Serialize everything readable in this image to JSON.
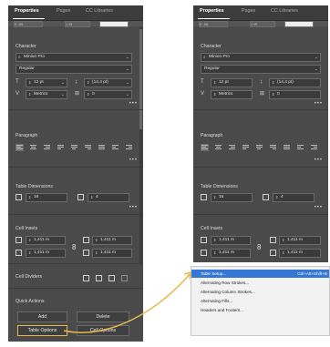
{
  "tabs": [
    "Properties",
    "Pages",
    "CC Libraries"
  ],
  "top_strip": {
    "left": "E..55",
    "mid": "1 IR"
  },
  "character": {
    "heading": "Character",
    "font": "Minion Pro",
    "style": "Regular",
    "size": "12 pt",
    "leading": "(14,4 pt)",
    "kerning": "Metrics",
    "tracking": "0"
  },
  "paragraph": {
    "heading": "Paragraph"
  },
  "table_dimensions": {
    "heading": "Table Dimensions",
    "rows": "16",
    "columns": "4"
  },
  "cell_insets": {
    "heading": "Cell Insets",
    "top": "1,411 m",
    "bottom": "1,411 m",
    "left": "1,411 m",
    "right": "1,411 m"
  },
  "cell_dividers": {
    "heading": "Cell Dividers"
  },
  "quick_actions": {
    "heading": "Quick Actions",
    "add": "Add",
    "delete": "Delete",
    "table_options": "Table Options",
    "cell_options": "Cell Options"
  },
  "right_panel": {
    "leading": "(14,4 pt)",
    "top": "1,411 m",
    "bottom": "1,411 m",
    "left": "1,411 m",
    "right": "1,411 m"
  },
  "menu": {
    "items": [
      {
        "label": "Table Setup...",
        "shortcut": "Ctrl+Alt+Shift+B"
      },
      {
        "label": "Alternating Row Strokes...",
        "shortcut": ""
      },
      {
        "label": "Alternating Column Strokes...",
        "shortcut": ""
      },
      {
        "label": "Alternating Fills...",
        "shortcut": ""
      },
      {
        "label": "Headers and Footers...",
        "shortcut": ""
      }
    ]
  },
  "colors": {
    "panel": "#4a4a4a",
    "highlight": "#e5b84a",
    "menu_selected": "#3478d4"
  }
}
